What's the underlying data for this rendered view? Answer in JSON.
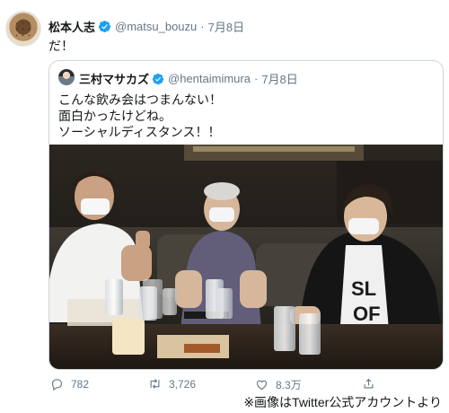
{
  "tweet": {
    "author_name": "松本人志",
    "handle": "@matsu_bouzu",
    "separator": "·",
    "date": "7月8日",
    "text": "だ！"
  },
  "quote": {
    "author_name": "三村マサカズ",
    "handle": "@hentaimimura",
    "separator": "·",
    "date": "7月8日",
    "lines": [
      "こんな飲み会はつまんない！",
      "面白かったけどね。",
      "ソーシャルディスタンス！！"
    ]
  },
  "actions": {
    "reply_count": "782",
    "retweet_count": "3,726",
    "like_count": "8.3万"
  },
  "caption": "※画像はTwitter公式アカウントより",
  "colors": {
    "verified": "#1da1f2",
    "secondary_text": "#657786",
    "border": "#ccd6dd"
  },
  "icons": [
    "verified-badge-icon",
    "reply-icon",
    "retweet-icon",
    "like-icon",
    "share-icon"
  ]
}
